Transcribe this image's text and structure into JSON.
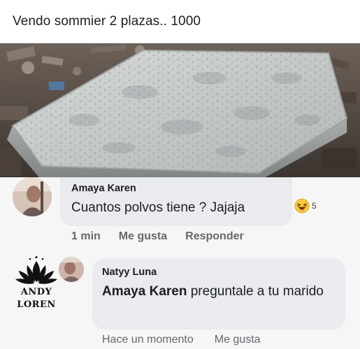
{
  "post": {
    "text": "Vendo sommier 2 plazas.. 1000"
  },
  "photo": {
    "subject": "mattress-image"
  },
  "comments": [
    {
      "author": "Amaya Karen",
      "text": "Cuantos polvos tiene ? Jajaja",
      "reaction_icon": "laughing-emoji-icon",
      "reaction_count": "5",
      "time": "1 min",
      "like_label": "Me gusta",
      "reply_label": "Responder"
    },
    {
      "author": "Natyy Luna",
      "mention": "Amaya Karen",
      "text_after_mention": " preguntale a tu marido",
      "time": "Hace un momento",
      "like_label": "Me gusta"
    }
  ],
  "watermark": {
    "line1": "ANDY",
    "line2": "LOREN",
    "icon": "lotus-icon"
  },
  "colors": {
    "bubble": "#e9ebee",
    "meta_text": "#65676b",
    "text": "#1c1e21"
  }
}
